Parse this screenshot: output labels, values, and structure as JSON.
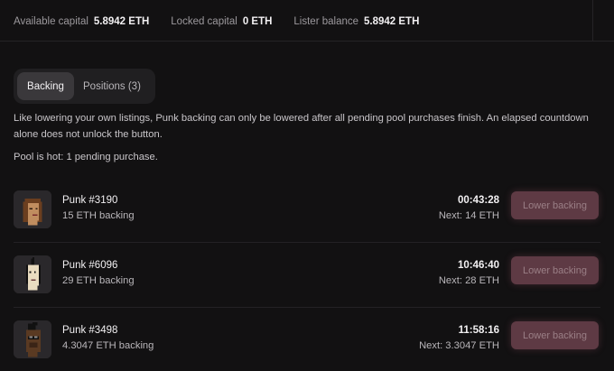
{
  "stats": {
    "available_label": "Available capital",
    "available_value": "5.8942 ETH",
    "locked_label": "Locked capital",
    "locked_value": "0 ETH",
    "lister_label": "Lister balance",
    "lister_value": "5.8942 ETH"
  },
  "tabs": [
    {
      "label": "Backing",
      "active": true
    },
    {
      "label": "Positions (3)",
      "active": false
    }
  ],
  "description": "Like lowering your own listings, Punk backing can only be lowered after all pending pool purchases finish. An elapsed countdown alone does not unlock the button.",
  "pool_status": "Pool is hot: 1 pending purchase.",
  "punks": [
    {
      "name": "Punk #3190",
      "backing": "15 ETH backing",
      "timer": "00:43:28",
      "next": "Next: 14 ETH",
      "button": "Lower backing"
    },
    {
      "name": "Punk #6096",
      "backing": "29 ETH backing",
      "timer": "10:46:40",
      "next": "Next: 28 ETH",
      "button": "Lower backing"
    },
    {
      "name": "Punk #3498",
      "backing": "4.3047 ETH backing",
      "timer": "11:58:16",
      "next": "Next: 3.3047 ETH",
      "button": "Lower backing"
    }
  ],
  "colors": {
    "background": "#121112",
    "disabled_button": "#5e3a44"
  }
}
